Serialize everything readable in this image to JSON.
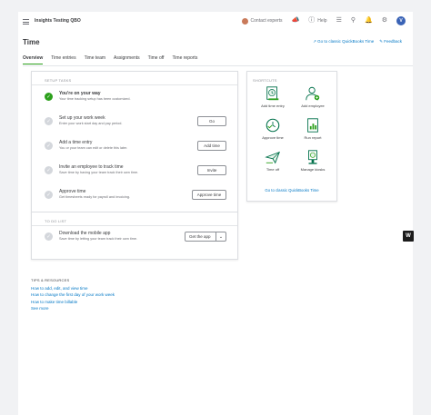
{
  "topbar": {
    "company": "Insights Testing QBO",
    "contact_experts": "Contact experts",
    "help": "Help",
    "user_initial": "V"
  },
  "page": {
    "title": "Time",
    "go_classic": "Go to classic QuickBooks Time",
    "feedback": "Feedback"
  },
  "tabs": [
    "Overview",
    "Time entries",
    "Time team",
    "Assignments",
    "Time off",
    "Time reports"
  ],
  "setup": {
    "label": "SETUP TASKS",
    "tasks": [
      {
        "title": "You're on your way",
        "desc": "Your time tracking setup has been customized.",
        "done": true,
        "button": ""
      },
      {
        "title": "Set up your work week",
        "desc": "Enter your work start day and pay period.",
        "done": false,
        "button": "Go"
      },
      {
        "title": "Add a time entry",
        "desc": "You or your team can edit or delete this later.",
        "done": false,
        "button": "Add time"
      },
      {
        "title": "Invite an employee to track time",
        "desc": "Save time by having your team track their own time.",
        "done": false,
        "button": "Invite"
      },
      {
        "title": "Approve time",
        "desc": "Get timesheets ready for payroll and invoicing.",
        "done": false,
        "button": "Approve time"
      }
    ]
  },
  "todo": {
    "label": "TO DO LIST",
    "title": "Download the mobile app",
    "desc": "Save time by letting your team track their own time.",
    "button": "Get the app"
  },
  "shortcuts": {
    "label": "SHORTCUTS",
    "items": [
      {
        "label": "Add time entry",
        "icon": "clock-doc-icon"
      },
      {
        "label": "Add employee",
        "icon": "add-person-icon"
      },
      {
        "label": "Approve time",
        "icon": "clock-check-icon"
      },
      {
        "label": "Run report",
        "icon": "report-icon"
      },
      {
        "label": "Time off",
        "icon": "plane-icon"
      },
      {
        "label": "Manage kiosks",
        "icon": "kiosk-icon"
      }
    ],
    "link": "Go to classic QuickBooks Time"
  },
  "tips": {
    "label": "TIPS & RESOURCES",
    "links": [
      "How to add, edit, and view time",
      "How to change the first day of your work week",
      "How to make time billable",
      "See more"
    ]
  },
  "badge": "W",
  "colors": {
    "accent": "#2ca01c",
    "link": "#0077c5",
    "text": "#393a3d"
  }
}
